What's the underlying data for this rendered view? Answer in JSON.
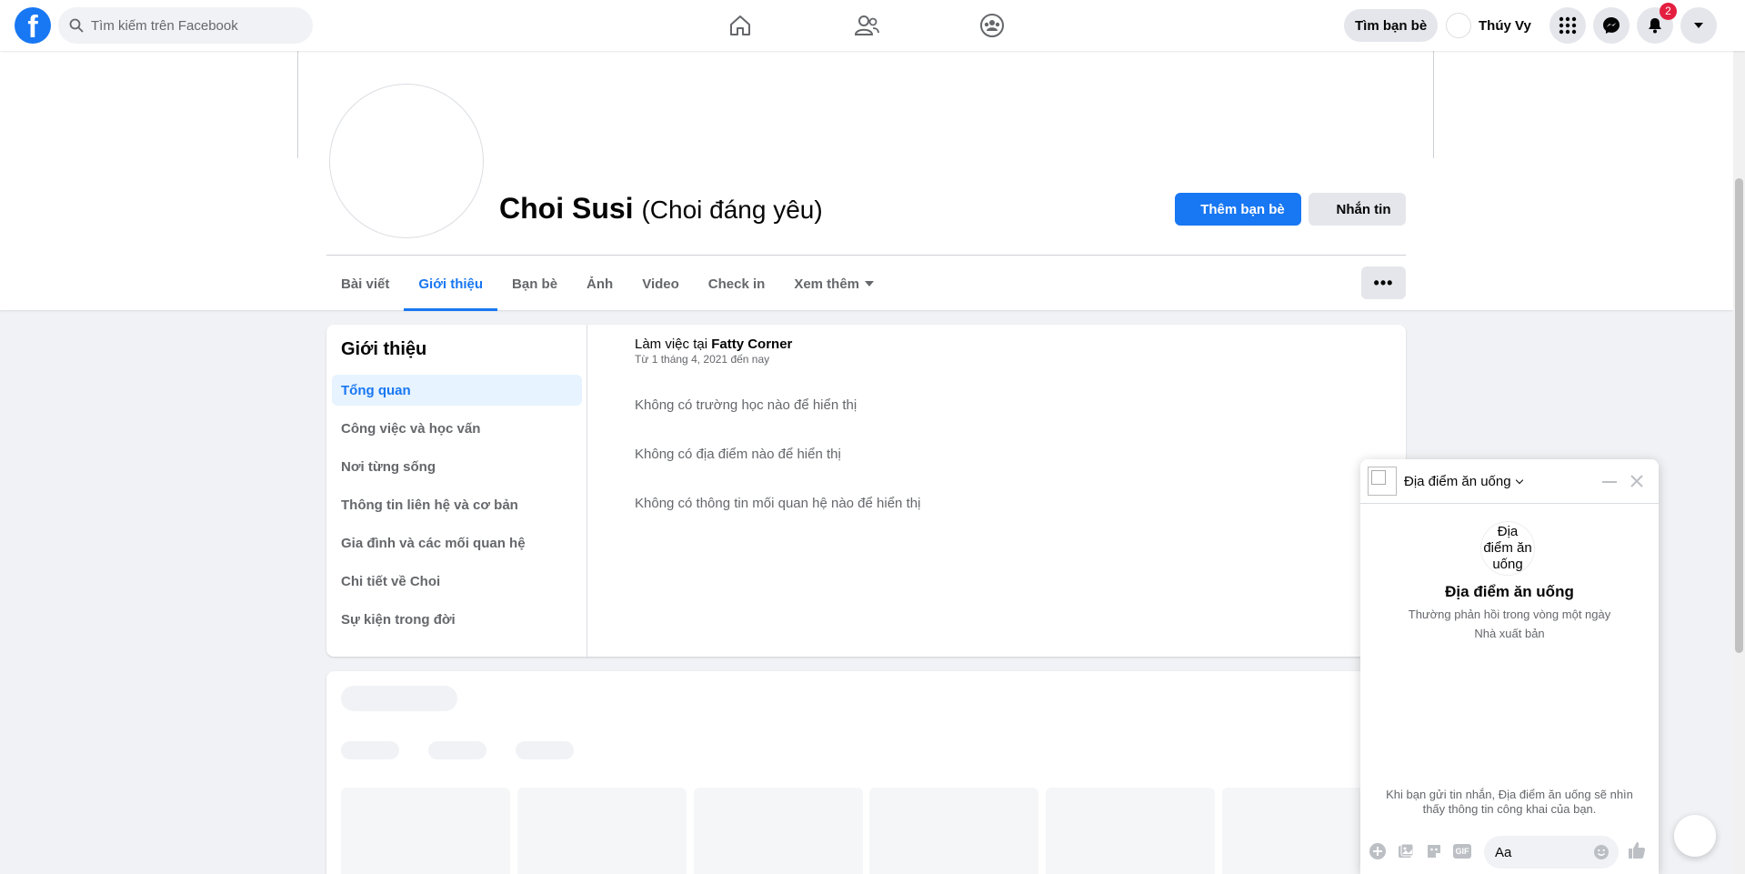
{
  "nav": {
    "logo_letter": "f",
    "search_placeholder": "Tìm kiếm trên Facebook",
    "find_friends": "Tìm bạn bè",
    "user_name": "Thúy Vy",
    "notification_count": "2"
  },
  "profile": {
    "name": "Choi Susi",
    "alt_name": "(Choi đáng yêu)",
    "add_friend": "Thêm bạn bè",
    "message": "Nhắn tin",
    "more_dots": "•••"
  },
  "tabs": [
    {
      "label": "Bài viết"
    },
    {
      "label": "Giới thiệu",
      "active": true
    },
    {
      "label": "Bạn bè"
    },
    {
      "label": "Ảnh"
    },
    {
      "label": "Video"
    },
    {
      "label": "Check in"
    },
    {
      "label": "Xem thêm"
    }
  ],
  "about": {
    "title": "Giới thiệu",
    "menu": [
      "Tổng quan",
      "Công việc và học vấn",
      "Nơi từng sống",
      "Thông tin liên hệ và cơ bản",
      "Gia đình và các mối quan hệ",
      "Chi tiết về Choi",
      "Sự kiện trong đời"
    ],
    "work_prefix": "Làm việc tại ",
    "work_place": "Fatty Corner",
    "work_since": "Từ 1 tháng 4, 2021 đến nay",
    "no_school": "Không có trường học nào để hiển thị",
    "no_place": "Không có địa điểm nào để hiển thị",
    "no_relationship": "Không có thông tin mối quan hệ nào để hiển thị"
  },
  "chat": {
    "title": "Địa điểm ăn uống",
    "avatar_alt": "Địa điểm ăn uống",
    "name": "Địa điểm ăn uống",
    "response_time": "Thường phản hồi trong vòng một ngày",
    "category": "Nhà xuất bản",
    "notice": "Khi bạn gửi tin nhắn, Địa điểm ăn uống sẽ nhìn thấy thông tin công khai của bạn.",
    "input_placeholder": "Aa",
    "gif_label": "GIF"
  },
  "colors": {
    "brand": "#1877f2",
    "badge": "#e41e3f",
    "background": "#f0f2f5"
  }
}
